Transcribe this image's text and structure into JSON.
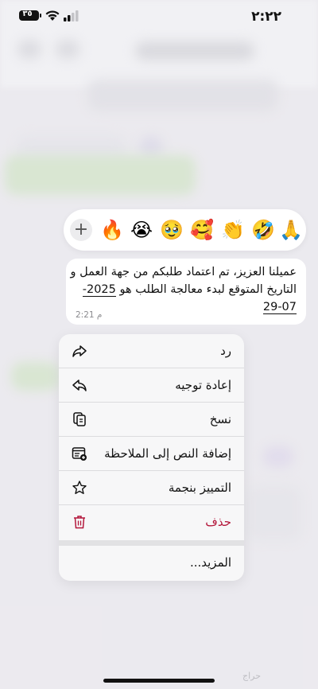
{
  "status_bar": {
    "time": "٢:٢٢",
    "battery": "٣٥"
  },
  "reactions": {
    "emojis": [
      "🙏",
      "🤣",
      "👏",
      "🥰",
      "🥹",
      "😭",
      "🔥"
    ],
    "more_symbol": "+"
  },
  "message": {
    "text_before_date": "عميلنا العزيز، تم اعتماد طلبكم من جهة العمل و التاريخ المتوقع لبدء معالجة الطلب هو",
    "date": "2025-07-29",
    "time": "2:21 م"
  },
  "menu": {
    "reply": "رد",
    "forward": "إعادة توجيه",
    "copy": "نسخ",
    "add_to_note": "إضافة النص إلى الملاحظة",
    "star": "التمييز بنجمة",
    "delete": "حذف",
    "more": "المزيد..."
  },
  "watermark": "حراج",
  "colors": {
    "delete": "#b3163a",
    "menu_bg": "#f7f7f8",
    "bubble_bg": "#ffffff"
  }
}
